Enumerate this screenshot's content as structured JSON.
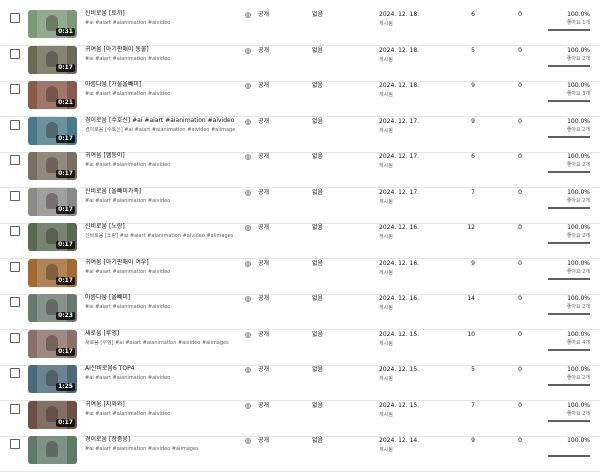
{
  "labels": {
    "visibility": "공개",
    "restrictions": "없음",
    "status": "게시됨"
  },
  "icons": {
    "checkbox": "checkbox-icon",
    "visibility": "globe-icon"
  },
  "videos": [
    {
      "title": "신비로움 [토끼]",
      "description": "#ai #aiart #aianimation #aivideo",
      "duration": "0:31",
      "date": "2024. 12. 18.",
      "views": "6",
      "comments": "0",
      "like_ratio": "100.0%",
      "likes": "좋아요 1개",
      "like_fraction": 1.0,
      "thumb_color": "#7a9a78"
    },
    {
      "title": "귀여움 [아기판매이 동물]",
      "description": "#ai #aiart #aianimation #aivideo",
      "duration": "0:17",
      "date": "2024. 12. 18.",
      "views": "5",
      "comments": "0",
      "like_ratio": "100.0%",
      "likes": "좋아요 2개",
      "like_fraction": 1.0,
      "thumb_color": "#6b6a55"
    },
    {
      "title": "아름다움 [거울올빼미]",
      "description": "#ai #aiart #aianimation #aivideo",
      "duration": "0:21",
      "date": "2024. 12. 18.",
      "views": "9",
      "comments": "0",
      "like_ratio": "100.0%",
      "likes": "좋아요 3개",
      "like_fraction": 1.0,
      "thumb_color": "#8a5a4a"
    },
    {
      "title": "경이로움 [수호신] #ai #aiart #aianimation #aivideo #aiima...",
      "description": "경이로움 [수호신] #ai #aiart #aianimation #aivideo #aiimages",
      "duration": "0:17",
      "date": "2024. 12. 17.",
      "views": "9",
      "comments": "0",
      "like_ratio": "100.0%",
      "likes": "좋아요 2개",
      "like_fraction": 1.0,
      "thumb_color": "#4a7a8a"
    },
    {
      "title": "귀여움 [햄둥이]",
      "description": "#ai #aiart #aianimation #aivideo",
      "duration": "0:17",
      "date": "2024. 12. 17.",
      "views": "6",
      "comments": "0",
      "like_ratio": "100.0%",
      "likes": "좋아요 2개",
      "like_fraction": 1.0,
      "thumb_color": "#7a6e60"
    },
    {
      "title": "신비로움 [올빼미가족]",
      "description": "#ai #aiart #aianimation #aivideo",
      "duration": "0:17",
      "date": "2024. 12. 17.",
      "views": "7",
      "comments": "0",
      "like_ratio": "100.0%",
      "likes": "좋아요 2개",
      "like_fraction": 1.0,
      "thumb_color": "#8a8a86"
    },
    {
      "title": "신비로움 [노랑]",
      "description": "신비로움 [노랑] #ai #aiart #aianimation #aivideo #aiimages",
      "duration": "0:17",
      "date": "2024. 12. 16.",
      "views": "12",
      "comments": "0",
      "like_ratio": "100.0%",
      "likes": "좋아요 2개",
      "like_fraction": 1.0,
      "thumb_color": "#5a6a50"
    },
    {
      "title": "귀여움 [아기판매이 여우]",
      "description": "#ai #aiart #aianimation #aivideo",
      "duration": "0:17",
      "date": "2024. 12. 16.",
      "views": "9",
      "comments": "0",
      "like_ratio": "100.0%",
      "likes": "좋아요 2개",
      "like_fraction": 1.0,
      "thumb_color": "#a06a30"
    },
    {
      "title": "아름다움 [올빼미]",
      "description": "#ai #aiart #aianimation #aivideo",
      "duration": "0:23",
      "date": "2024. 12. 16.",
      "views": "14",
      "comments": "0",
      "like_ratio": "100.0%",
      "likes": "좋아요 2개",
      "like_fraction": 1.0,
      "thumb_color": "#6a7a70"
    },
    {
      "title": "새로움 [루엥]",
      "description": "새로움 [루엥] #ai #aiart #aianimation #aivideo #aiimages",
      "duration": "0:17",
      "date": "2024. 12. 15.",
      "views": "10",
      "comments": "0",
      "like_ratio": "100.0%",
      "likes": "좋아요 4개",
      "like_fraction": 1.0,
      "thumb_color": "#8a7068"
    },
    {
      "title": "AI신비로움6 TOP4",
      "description": "#ai #aiart #aianimation #aivideo",
      "duration": "1:25",
      "date": "2024. 12. 15.",
      "views": "5",
      "comments": "0",
      "like_ratio": "100.0%",
      "likes": "좋아요 2개",
      "like_fraction": 1.0,
      "thumb_color": "#4a6a7a"
    },
    {
      "title": "귀여움 [지와와]",
      "description": "#ai #aiart #aianimation #aivideo",
      "duration": "0:17",
      "date": "2024. 12. 15.",
      "views": "7",
      "comments": "0",
      "like_ratio": "100.0%",
      "likes": "좋아요 2개",
      "like_fraction": 1.0,
      "thumb_color": "#6a5045"
    },
    {
      "title": "경이로움 [장중웅]",
      "description": "#ai #aiart #aianimation #aivideo #aiimages",
      "duration": "",
      "date": "2024. 12. 14.",
      "views": "9",
      "comments": "0",
      "like_ratio": "100.0%",
      "likes": "",
      "like_fraction": 1.0,
      "thumb_color": "#607a6a"
    }
  ]
}
